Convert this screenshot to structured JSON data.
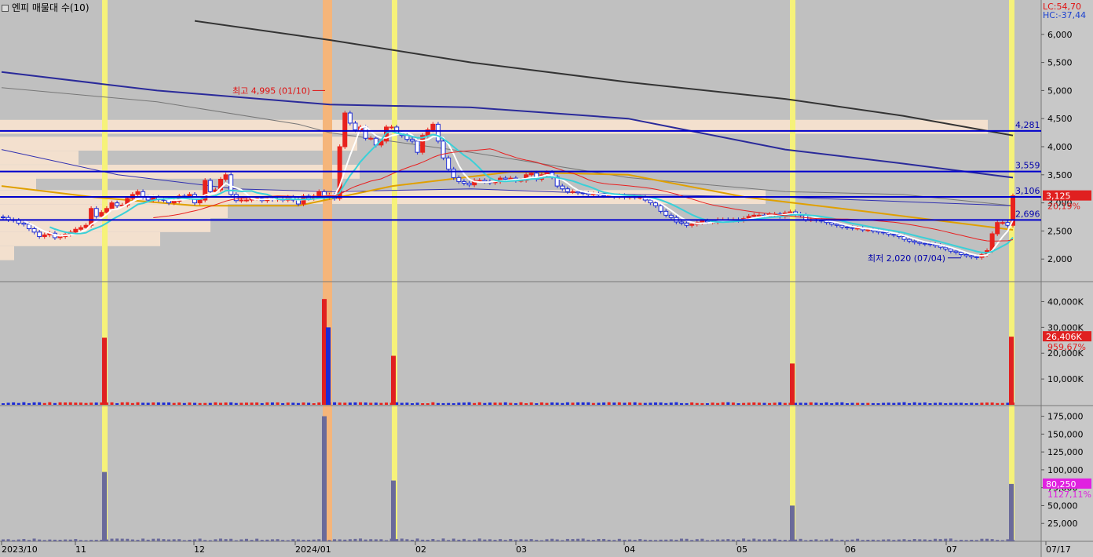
{
  "window": {
    "title": "엔피 매물대 수(10)"
  },
  "price_panel": {
    "lc_label": "LC:54,70",
    "hc_label": "HC:-37,44",
    "y_ticks": [
      "6,000",
      "5,500",
      "5,000",
      "4,500",
      "4,000",
      "3,500",
      "3,000",
      "2,500",
      "2,000"
    ],
    "current_price": "3,125",
    "current_change": "20,19%",
    "hlines": [
      {
        "value": 4281,
        "label": "4,281"
      },
      {
        "value": 3559,
        "label": "3,559"
      },
      {
        "value": 3106,
        "label": "3,106"
      },
      {
        "value": 2696,
        "label": "2,696"
      }
    ],
    "high_annotation": "최고 4,995 (01/10)",
    "low_annotation": "최저 2,020 (07/04)",
    "colors": {
      "up": "#e8221d",
      "down": "#1c2bd6",
      "hline": "#0000cc",
      "highlight_yellow": "#f6f27a",
      "highlight_orange": "#f5b57a",
      "volume_profile": "#f5e1cf"
    }
  },
  "volume_panel": {
    "y_ticks": [
      "40,000K",
      "30,000K",
      "20,000K",
      "10,000K"
    ],
    "current_value": "26,406K",
    "current_change": "959,67%"
  },
  "amount_panel": {
    "y_ticks": [
      "175,000",
      "150,000",
      "125,000",
      "100,000",
      "75,000",
      "50,000",
      "25,000"
    ],
    "current_value": "80,250",
    "current_change": "1127,11%",
    "bar_color": "#6a6a9a"
  },
  "x_axis": {
    "labels": [
      "2023/10",
      "11",
      "12",
      "2024/01",
      "02",
      "03",
      "04",
      "05",
      "06",
      "07",
      "07/17"
    ]
  },
  "chart_data": {
    "type": "candlestick",
    "title": "엔피 매물대 수(10)",
    "x_range": [
      "2023/10",
      "2024/07/17"
    ],
    "price_ylim": [
      1500,
      6500
    ],
    "volume_ylim": [
      0,
      45000
    ],
    "amount_ylim": [
      0,
      180000
    ],
    "candles": {
      "open": [
        2750,
        2740,
        2700,
        2690,
        2640,
        2620,
        2540,
        2480,
        2400,
        2430,
        2460,
        2380,
        2400,
        2440,
        2480,
        2530,
        2560,
        2600,
        2900,
        2760,
        2830,
        2900,
        3000,
        2950,
        2960,
        3080,
        3150,
        3200,
        3100,
        3050,
        3100,
        3060,
        3050,
        3000,
        3030,
        3120,
        3100,
        3150,
        3000,
        3050,
        3400,
        3200,
        3230,
        3420,
        3500,
        3150,
        3040,
        3050,
        3050,
        3080,
        3080,
        3040,
        3080,
        3060,
        3070,
        3050,
        3100,
        3050,
        2980,
        3120,
        3080,
        3120,
        3200,
        3100,
        3140,
        3080,
        4000,
        4600,
        4420,
        4300,
        4350,
        4150,
        4150,
        4030,
        4100,
        4350,
        4350,
        4250,
        4200,
        4130,
        4100,
        3900,
        4200,
        4300,
        4400,
        4100,
        3800,
        3600,
        3450,
        3380,
        3350,
        3320,
        3400,
        3400,
        3380,
        3360,
        3380,
        3440,
        3420,
        3440,
        3400,
        3400,
        3500,
        3530,
        3420,
        3500,
        3540,
        3460,
        3300,
        3250,
        3200,
        3200,
        3180,
        3170,
        3150,
        3160,
        3140,
        3130,
        3130,
        3110,
        3130,
        3100,
        3110,
        3100,
        3100,
        3050,
        3000,
        2950,
        2850,
        2780,
        2740,
        2660,
        2640,
        2600,
        2620,
        2650,
        2680,
        2660,
        2660,
        2700,
        2700,
        2690,
        2700,
        2690,
        2720,
        2760,
        2780,
        2780,
        2770,
        2800,
        2800,
        2760,
        2820,
        2840,
        2800,
        2780,
        2700,
        2700,
        2690,
        2680,
        2650,
        2620,
        2600,
        2570,
        2560,
        2550,
        2550,
        2520,
        2520,
        2500,
        2480,
        2470,
        2440,
        2430,
        2400,
        2350,
        2320,
        2300,
        2280,
        2270,
        2260,
        2240,
        2210,
        2180,
        2140,
        2120,
        2080,
        2060,
        2040,
        2030,
        2080,
        2150,
        2450,
        2650,
        2650,
        2600
      ],
      "close": [
        2740,
        2700,
        2690,
        2640,
        2620,
        2540,
        2480,
        2400,
        2430,
        2460,
        2380,
        2400,
        2440,
        2480,
        2530,
        2560,
        2600,
        2900,
        2760,
        2830,
        2900,
        3000,
        2950,
        2960,
        3080,
        3150,
        3200,
        3100,
        3050,
        3100,
        3060,
        3050,
        3000,
        3030,
        3120,
        3100,
        3150,
        3000,
        3050,
        3400,
        3200,
        3230,
        3420,
        3500,
        3150,
        3040,
        3050,
        3050,
        3080,
        3080,
        3040,
        3080,
        3060,
        3070,
        3050,
        3100,
        3050,
        2980,
        3120,
        3080,
        3120,
        3200,
        3100,
        3140,
        3080,
        4000,
        4600,
        4420,
        4300,
        4350,
        4150,
        4150,
        4030,
        4100,
        4350,
        4350,
        4250,
        4200,
        4130,
        4100,
        3900,
        4200,
        4300,
        4400,
        4100,
        3800,
        3600,
        3450,
        3380,
        3350,
        3320,
        3400,
        3400,
        3380,
        3360,
        3380,
        3440,
        3420,
        3440,
        3400,
        3400,
        3500,
        3530,
        3420,
        3500,
        3540,
        3460,
        3300,
        3250,
        3200,
        3200,
        3180,
        3170,
        3150,
        3160,
        3140,
        3130,
        3130,
        3110,
        3130,
        3100,
        3110,
        3100,
        3100,
        3050,
        3000,
        2950,
        2850,
        2780,
        2740,
        2660,
        2640,
        2600,
        2620,
        2650,
        2680,
        2660,
        2660,
        2700,
        2700,
        2690,
        2700,
        2690,
        2720,
        2760,
        2780,
        2780,
        2770,
        2800,
        2800,
        2760,
        2820,
        2840,
        2800,
        2780,
        2700,
        2700,
        2690,
        2680,
        2650,
        2620,
        2600,
        2570,
        2560,
        2550,
        2550,
        2520,
        2520,
        2500,
        2480,
        2470,
        2440,
        2430,
        2400,
        2350,
        2320,
        2300,
        2280,
        2270,
        2260,
        2240,
        2210,
        2180,
        2140,
        2120,
        2080,
        2060,
        2040,
        2030,
        2080,
        2150,
        2450,
        2650,
        2650,
        2600,
        3125
      ],
      "high_label": {
        "value": 4995,
        "date": "01/10"
      },
      "low_label": {
        "value": 2020,
        "date": "07/04"
      }
    },
    "volume_spikes": [
      {
        "month": "11",
        "value": 26000
      },
      {
        "month": "2024/01",
        "value": 41000
      },
      {
        "month": "02",
        "value": 19000
      },
      {
        "month": "05",
        "value": 16000
      },
      {
        "month": "07",
        "value": 26406
      }
    ],
    "amount_spikes": [
      {
        "month": "11",
        "value": 97000
      },
      {
        "month": "2024/01",
        "value": 175000
      },
      {
        "month": "02",
        "value": 85000
      },
      {
        "month": "05",
        "value": 50000
      },
      {
        "month": "07",
        "value": 80250
      }
    ]
  }
}
